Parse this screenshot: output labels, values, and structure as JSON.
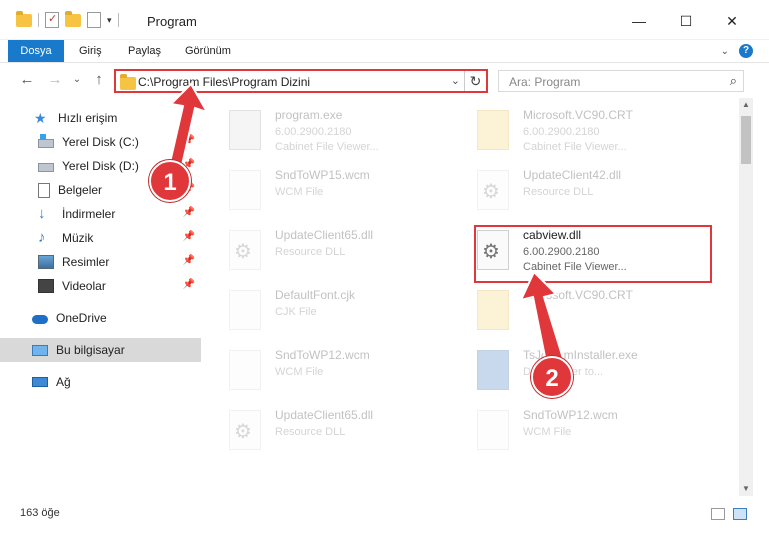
{
  "window": {
    "title": "Program",
    "minimize": "—",
    "maximize": "☐",
    "close": "✕"
  },
  "ribbon": {
    "file_tab": "Dosya",
    "tabs": [
      "Giriş",
      "Paylaş",
      "Görünüm"
    ],
    "collapse": "⌄",
    "help": "?"
  },
  "nav": {
    "back": "←",
    "forward": "→",
    "recent": "⌄",
    "up": "↑",
    "address": "C:\\Program Files\\Program Dizini",
    "address_dropdown": "⌄",
    "refresh": "↻",
    "search_placeholder": "Ara: Program",
    "search_icon": "search-icon"
  },
  "sidebar": {
    "items": [
      {
        "label": "Hızlı erişim",
        "icon": "star-icon",
        "pinned": false
      },
      {
        "label": "Yerel Disk (C:)",
        "icon": "disk-icon",
        "pinned": true
      },
      {
        "label": "Yerel Disk (D:)",
        "icon": "disk-icon",
        "pinned": true
      },
      {
        "label": "Belgeler",
        "icon": "document-icon",
        "pinned": true
      },
      {
        "label": "İndirmeler",
        "icon": "download-icon",
        "pinned": true
      },
      {
        "label": "Müzik",
        "icon": "music-icon",
        "pinned": true
      },
      {
        "label": "Resimler",
        "icon": "pictures-icon",
        "pinned": true
      },
      {
        "label": "Videolar",
        "icon": "video-icon",
        "pinned": true
      },
      {
        "label": "OneDrive",
        "icon": "cloud-icon",
        "pinned": false
      },
      {
        "label": "Bu bilgisayar",
        "icon": "computer-icon",
        "pinned": false,
        "selected": true
      },
      {
        "label": "Ağ",
        "icon": "network-icon",
        "pinned": false
      }
    ],
    "pin_glyph": "📌"
  },
  "files": [
    {
      "name": "program.exe",
      "line2": "6.00.2900.2180",
      "line3": "Cabinet File Viewer...",
      "icon": "exe-icon",
      "faded": true
    },
    {
      "name": "Microsoft.VC90.CRT",
      "line2": "6.00.2900.2180",
      "line3": "Cabinet File Viewer...",
      "icon": "folder-icon",
      "faded": true
    },
    {
      "name": "SndToWP15.wcm",
      "line2": "WCM File",
      "line3": "",
      "icon": "file-icon",
      "faded": true
    },
    {
      "name": "UpdateClient42.dll",
      "line2": "Resource DLL",
      "line3": "",
      "icon": "gear-file-icon",
      "faded": true
    },
    {
      "name": "UpdateClient65.dll",
      "line2": "Resource DLL",
      "line3": "",
      "icon": "gear-file-icon",
      "faded": true
    },
    {
      "name": "cabview.dll",
      "line2": "6.00.2900.2180",
      "line3": "Cabinet File Viewer...",
      "icon": "gear-file-icon",
      "faded": false
    },
    {
      "name": "DefaultFont.cjk",
      "line2": "CJK File",
      "line3": "",
      "icon": "file-icon",
      "faded": true
    },
    {
      "name": "Microsoft.VC90.CRT",
      "line2": "",
      "line3": "",
      "icon": "folder-icon",
      "faded": true
    },
    {
      "name": "SndToWP12.wcm",
      "line2": "WCM File",
      "line3": "",
      "icon": "file-icon",
      "faded": true
    },
    {
      "name": "TsJcommInstaller.exe",
      "line2": "Downloader to...",
      "line3": "",
      "icon": "app-icon",
      "faded": true
    },
    {
      "name": "UpdateClient65.dll",
      "line2": "Resource DLL",
      "line3": "",
      "icon": "gear-file-icon",
      "faded": true
    },
    {
      "name": "SndToWP12.wcm",
      "line2": "WCM File",
      "line3": "",
      "icon": "file-icon",
      "faded": true
    }
  ],
  "status": {
    "count": "163 öğe"
  },
  "callouts": [
    "1",
    "2"
  ],
  "colors": {
    "accent": "#1979ca",
    "highlight": "#e0373b"
  }
}
